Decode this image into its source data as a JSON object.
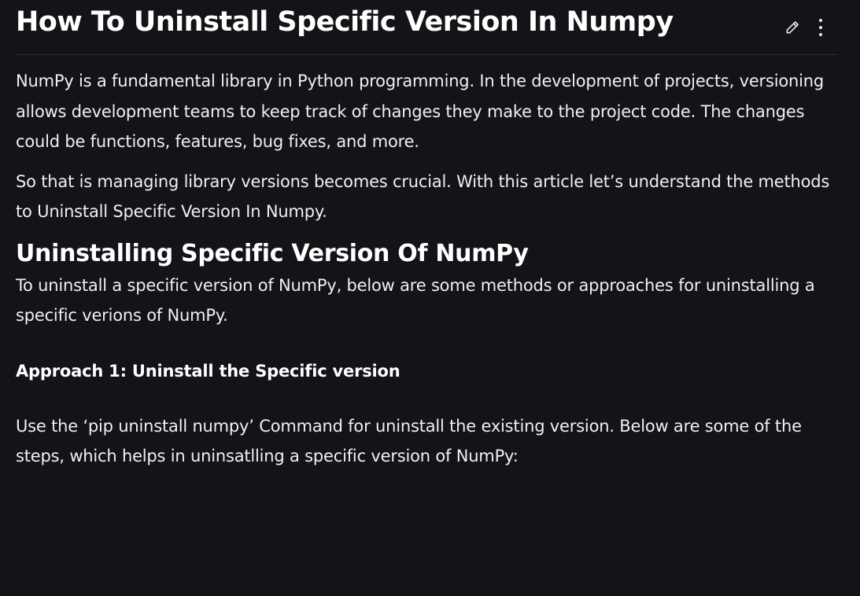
{
  "article": {
    "title": "How To Uninstall Specific Version In Numpy",
    "intro_paragraph_1": "NumPy is a fundamental library in Python programming. In the development of projects, versioning allows development teams to keep track of changes they make to the project code. The changes could be functions, features, bug fixes, and more.",
    "intro_paragraph_2": "So that is managing library versions becomes crucial. With this article let’s understand the methods to Uninstall Specific Version In Numpy.",
    "section_heading": "Uninstalling Specific Version Of NumPy",
    "section_paragraph": "To uninstall a specific version of NumPy, below are some methods or approaches for uninstalling a specific verions of NumPy.",
    "approach_heading": "Approach 1: Uninstall the Specific version",
    "approach_paragraph": "Use the ‘pip uninstall numpy’ Command for uninstall the existing version. Below are some of the steps, which helps in uninsatlling a specific version of NumPy:"
  },
  "toolbar": {
    "edit_icon": "pencil-icon",
    "more_icon": "vertical-ellipsis-icon"
  },
  "colors": {
    "background": "#131418",
    "text": "#f0f0f0",
    "divider": "#2e3036"
  }
}
